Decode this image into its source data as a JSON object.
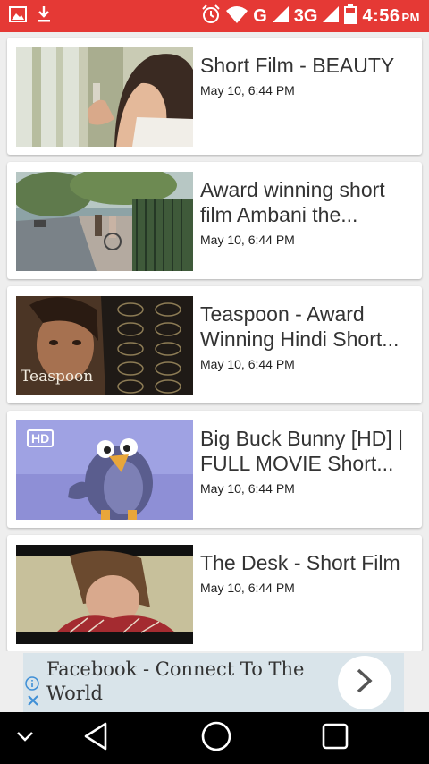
{
  "status_bar": {
    "time": "4:56",
    "ampm": "PM",
    "network_g": "G",
    "network_3g": "3G",
    "icons": [
      "gallery-icon",
      "download-icon",
      "alarm-icon",
      "wifi-icon",
      "signal-icon",
      "signal-icon",
      "battery-icon"
    ]
  },
  "videos": [
    {
      "title": "Short Film - BEAUTY",
      "date": "May 10, 6:44 PM"
    },
    {
      "title": "Award winning short film Ambani the...",
      "date": "May 10, 6:44 PM"
    },
    {
      "title": "Teaspoon - Award Winning Hindi Short...",
      "date": "May 10, 6:44 PM",
      "thumb_text": "Teaspoon"
    },
    {
      "title": "Big Buck Bunny [HD] | FULL MOVIE Short...",
      "date": "May 10, 6:44 PM",
      "thumb_badge": "HD"
    },
    {
      "title": "The Desk - Short Film",
      "date": "May 10, 6:44 PM"
    }
  ],
  "ad": {
    "text": "Facebook - Connect To The World",
    "info_icon": "info-icon",
    "close_icon": "close-icon",
    "action_icon": "chevron-right-icon"
  },
  "nav_bar": {
    "icons": [
      "chevron-down-icon",
      "back-icon",
      "home-icon",
      "recents-icon"
    ]
  }
}
